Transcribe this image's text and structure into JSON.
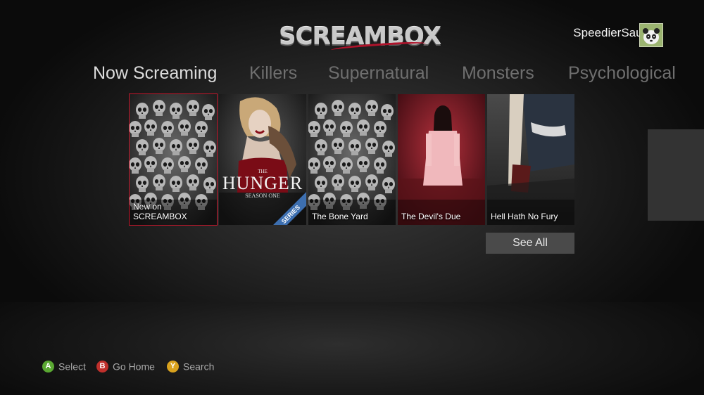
{
  "app": {
    "logo_text": "SCREAMBOX"
  },
  "user": {
    "gamertag": "SpeedierSauce7",
    "avatar_icon": "panda-avatar-icon"
  },
  "nav": {
    "tabs": [
      {
        "label": "Now Screaming",
        "active": true
      },
      {
        "label": "Killers",
        "active": false
      },
      {
        "label": "Supernatural",
        "active": false
      },
      {
        "label": "Monsters",
        "active": false
      },
      {
        "label": "Psychological",
        "active": false
      }
    ]
  },
  "tiles": [
    {
      "label": "New on SCREAMBOX",
      "selected": true
    },
    {
      "label": "",
      "poster_title": "THE",
      "poster_main": "HUNGER",
      "poster_sub": "SEASON ONE",
      "badge": "SERIES"
    },
    {
      "label": "The Bone Yard"
    },
    {
      "label": "The Devil's Due"
    },
    {
      "label": "Hell Hath No Fury"
    }
  ],
  "see_all_label": "See All",
  "hints": [
    {
      "key": "A",
      "label": "Select",
      "color": "#5aa832"
    },
    {
      "key": "B",
      "label": "Go Home",
      "color": "#c0302c"
    },
    {
      "key": "Y",
      "label": "Search",
      "color": "#d9a21e"
    }
  ],
  "colors": {
    "selection": "#c4162b",
    "accent": "#b0132b"
  }
}
